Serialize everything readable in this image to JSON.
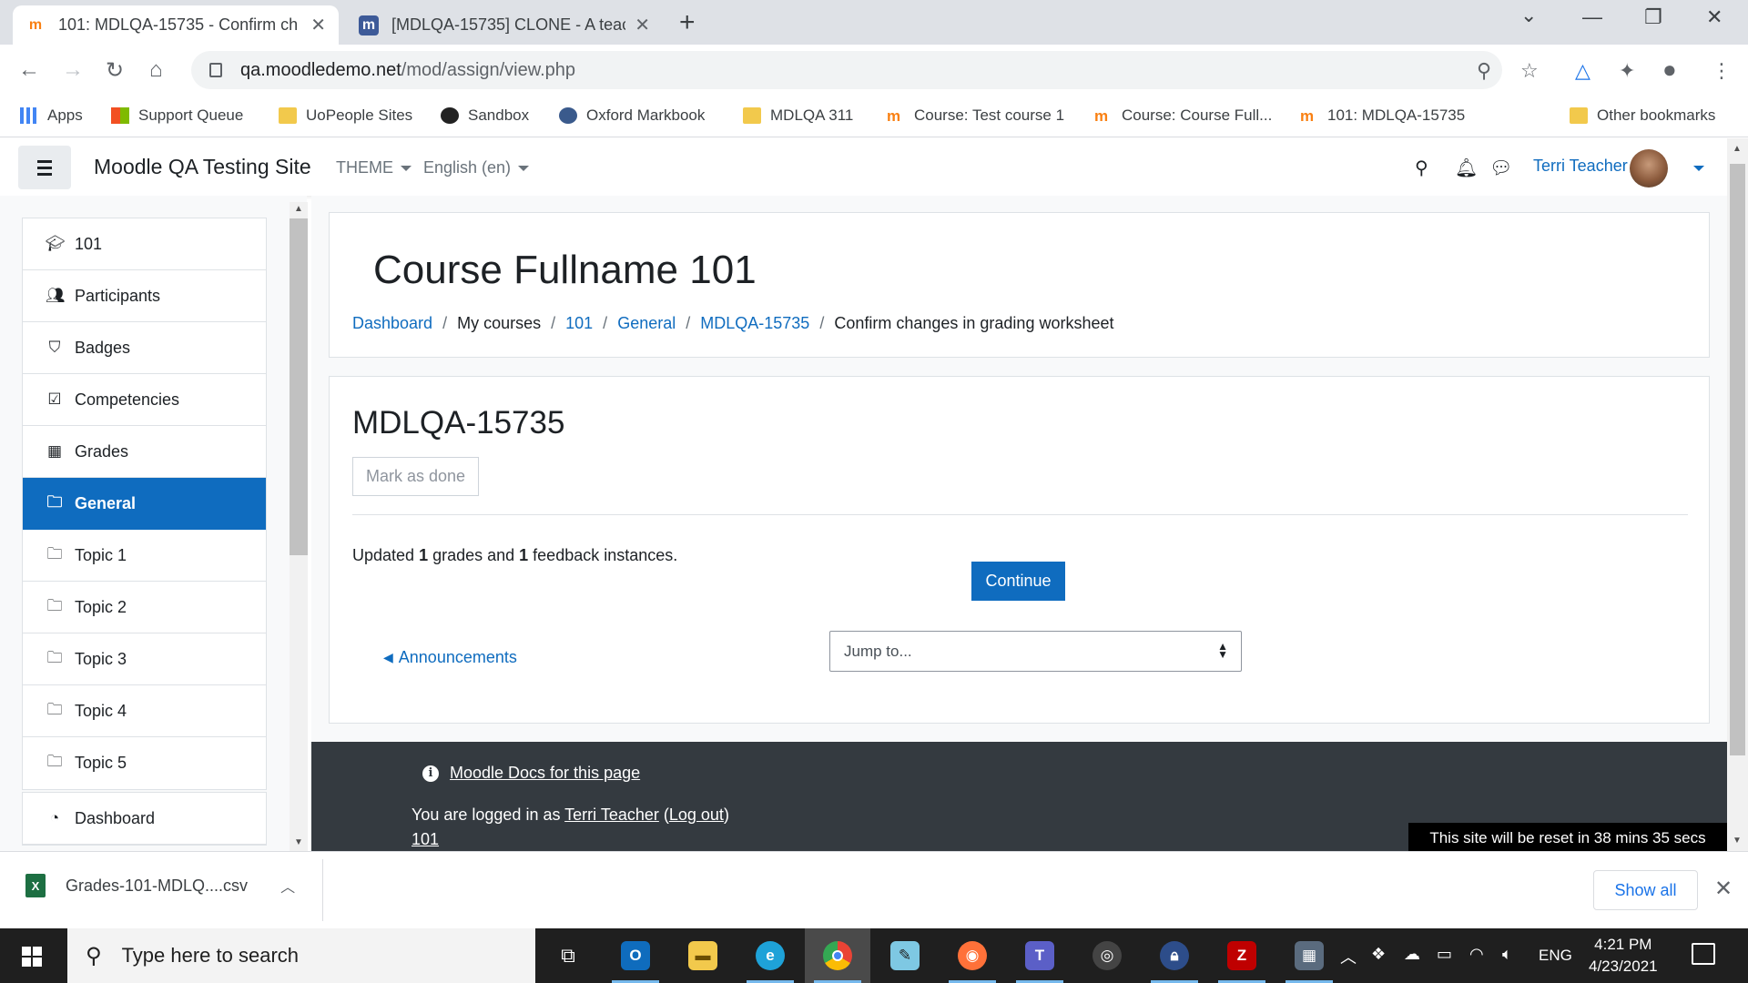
{
  "browser": {
    "tabs": [
      {
        "title": "101: MDLQA-15735 - Confirm ch",
        "active": true
      },
      {
        "title": "[MDLQA-15735] CLONE - A teach",
        "active": false
      }
    ],
    "url_host": "qa.moodledemo.net",
    "url_path": "/mod/assign/view.php",
    "bookmarks": [
      "Apps",
      "Support Queue",
      "UoPeople Sites",
      "Sandbox",
      "Oxford Markbook",
      "MDLQA 311",
      "Course: Test course 1",
      "Course: Course Full...",
      "101: MDLQA-15735",
      "Other bookmarks"
    ]
  },
  "navbar": {
    "site_name": "Moodle QA Testing Site",
    "theme_label": "THEME",
    "language_label": "English (en)",
    "user_name": "Terri Teacher"
  },
  "drawer": {
    "items": [
      {
        "label": "101",
        "icon": "graduation-cap-icon"
      },
      {
        "label": "Participants",
        "icon": "users-icon"
      },
      {
        "label": "Badges",
        "icon": "shield-icon"
      },
      {
        "label": "Competencies",
        "icon": "check-square-icon"
      },
      {
        "label": "Grades",
        "icon": "table-icon"
      },
      {
        "label": "General",
        "icon": "folder-icon",
        "active": true
      },
      {
        "label": "Topic 1",
        "icon": "folder-icon"
      },
      {
        "label": "Topic 2",
        "icon": "folder-icon"
      },
      {
        "label": "Topic 3",
        "icon": "folder-icon"
      },
      {
        "label": "Topic 4",
        "icon": "folder-icon"
      },
      {
        "label": "Topic 5",
        "icon": "folder-icon"
      }
    ],
    "dashboard_label": "Dashboard"
  },
  "page": {
    "course_title": "Course Fullname 101",
    "breadcrumb": {
      "dashboard": "Dashboard",
      "my_courses": "My courses",
      "course": "101",
      "section": "General",
      "activity": "MDLQA-15735",
      "current": "Confirm changes in grading worksheet"
    },
    "activity_title": "MDLQA-15735",
    "mark_done_label": "Mark as done",
    "updated_prefix": "Updated ",
    "updated_grades": "1",
    "updated_middle": " grades and ",
    "updated_feedback": "1",
    "updated_suffix": " feedback instances.",
    "continue_label": "Continue",
    "prev_link": "Announcements",
    "jump_placeholder": "Jump to..."
  },
  "footer": {
    "docs_link": "Moodle Docs for this page",
    "logged_in_prefix": "You are logged in as ",
    "user_link": "Terri Teacher",
    "open_paren": " (",
    "logout_link": "Log out",
    "close_paren": ")",
    "course_link": "101",
    "reset_notice": "This site will be reset in 38 mins 35 secs"
  },
  "downloads": {
    "file_name": "Grades-101-MDLQ....csv",
    "show_all": "Show all"
  },
  "taskbar": {
    "search_placeholder": "Type here to search",
    "language": "ENG",
    "time": "4:21 PM",
    "date": "4/23/2021"
  },
  "colors": {
    "primary": "#0f6cbf",
    "footer_bg": "#343a40",
    "taskbar_bg": "#1f1f1f"
  }
}
